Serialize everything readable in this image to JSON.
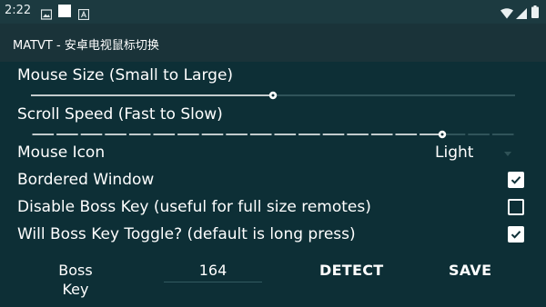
{
  "status_bar": {
    "time": "2:22",
    "icons": [
      "image-icon",
      "white-square-icon",
      "a-box-icon",
      "wifi-icon",
      "signal-icon",
      "battery-icon"
    ]
  },
  "app_bar": {
    "title": "MATVT - 安卓电视鼠标切换"
  },
  "settings": {
    "mouse_size": {
      "label": "Mouse Size (Small to Large)",
      "value_fraction": 0.5
    },
    "scroll_speed": {
      "label": "Scroll Speed (Fast to Slow)",
      "value_fraction": 0.85
    },
    "mouse_icon": {
      "label": "Mouse Icon",
      "value": "Light"
    },
    "bordered_window": {
      "label": "Bordered Window",
      "checked": true
    },
    "disable_boss_key": {
      "label": "Disable Boss Key (useful for full size remotes)",
      "checked": false
    },
    "boss_key_toggle": {
      "label": "Will Boss Key Toggle? (default is long press)",
      "checked": true
    }
  },
  "boss_key": {
    "label": "Boss Key",
    "value": "164",
    "detect_label": "DETECT",
    "save_label": "SAVE"
  },
  "colors": {
    "background": "#0d2f36",
    "app_bar": "#1a3339",
    "status_bar": "#1c3a40",
    "accent": "#ffffff"
  }
}
